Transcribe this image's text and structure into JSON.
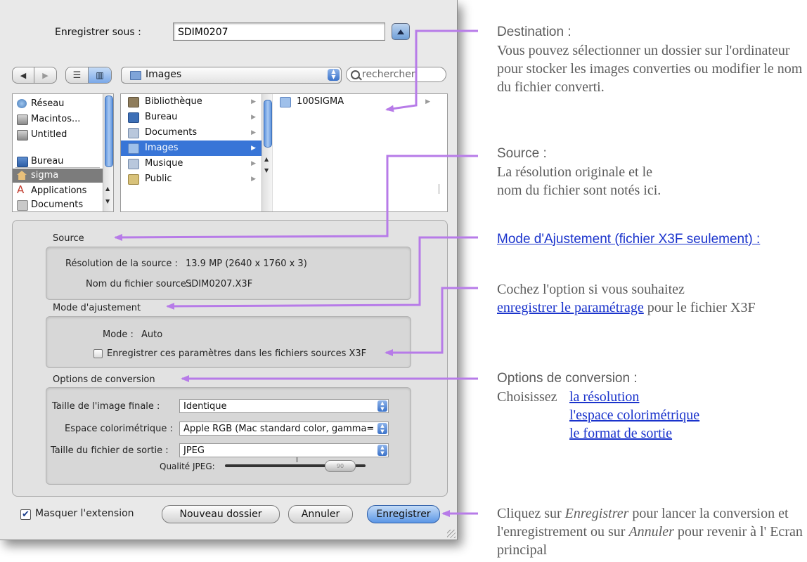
{
  "dialog": {
    "save_as_label": "Enregistrer sous :",
    "filename_value": "SDIM0207",
    "location_popup": "Images",
    "search_placeholder": "rechercher",
    "sidebar": [
      {
        "label": "Réseau",
        "icon": "globe-icon"
      },
      {
        "label": "Macintos...",
        "icon": "hard-disk-icon"
      },
      {
        "label": "Untitled",
        "icon": "hard-disk-icon"
      },
      {
        "label": "Bureau",
        "icon": "desktop-icon"
      },
      {
        "label": "sigma",
        "icon": "home-icon"
      },
      {
        "label": "Applications",
        "icon": "applications-icon"
      },
      {
        "label": "Documents",
        "icon": "documents-folder-icon"
      }
    ],
    "column1": [
      "Bibliothèque",
      "Bureau",
      "Documents",
      "Images",
      "Musique",
      "Public"
    ],
    "column2": [
      "100SIGMA"
    ],
    "source": {
      "title": "Source",
      "resolution_label": "Résolution de la source :",
      "resolution_value": "13.9 MP (2640 x 1760 x 3)",
      "filename_label": "Nom du fichier source :",
      "filename_value": "SDIM0207.X3F"
    },
    "adjust": {
      "title": "Mode d'ajustement",
      "mode_label": "Mode :",
      "mode_value": "Auto",
      "checkbox_label": "Enregistrer ces paramètres dans les fichiers sources X3F"
    },
    "conversion": {
      "title": "Options de conversion",
      "size_label": "Taille de l'image finale :",
      "size_value": "Identique",
      "colorspace_label": "Espace colorimétrique :",
      "colorspace_value": "Apple RGB (Mac standard color, gamma=",
      "filetype_label": "Taille du fichier de sortie :",
      "filetype_value": "JPEG",
      "quality_label": "Qualité JPEG:",
      "knob_text": "90"
    },
    "buttons": {
      "hide_extension": "Masquer l'extension",
      "new_folder": "Nouveau dossier",
      "cancel": "Annuler",
      "save": "Enregistrer"
    }
  },
  "notes": {
    "destination_head": "Destination :",
    "destination_body": "Vous pouvez sélectionner un dossier sur l'ordinateur pour stocker les images converties ou modifier le nom du fichier converti.",
    "source_head": "Source :",
    "source_body": "La résolution originale et le nom du fichier sont notés ici.",
    "mode_head": "Mode d'Ajustement (fichier X3F seulement) :",
    "mode_body_pre": "Cochez l'option si vous souhaitez",
    "mode_body_link": "enregistrer le paramétrage",
    "mode_body_post": "pour le fichier X3F",
    "options_head": "Options de conversion :",
    "options_choose": "Choisissez",
    "options_links": [
      "la résolution",
      "l'espace colorimétrique",
      "le format de sortie"
    ],
    "save_pre": "Cliquez sur",
    "save_italic1": "Enregistrer",
    "save_mid": "pour lancer la conversion et l'enregistrement ou sur",
    "save_italic2": "Annuler",
    "save_post": "pour revenir à l' Ecran principal"
  },
  "colors": {
    "arrow": "#b77be8",
    "link": "#1a33cc",
    "selection": "#3875d7"
  }
}
